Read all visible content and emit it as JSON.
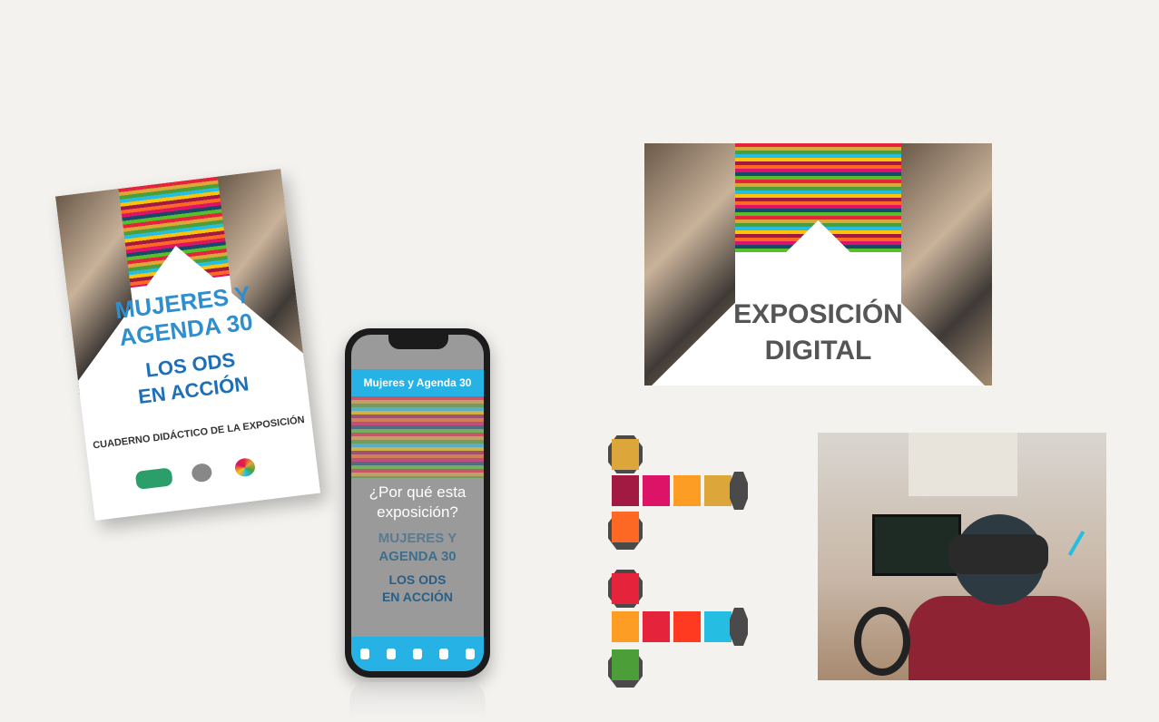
{
  "booklet": {
    "title_line1": "MUJERES Y",
    "title_line2": "AGENDA 30",
    "title_line3": "LOS ODS",
    "title_line4": "EN ACCIÓN",
    "subtitle": "CUADERNO DIDÁCTICO DE LA EXPOSICIÓN"
  },
  "phone": {
    "app_title": "Mujeres y Agenda 30",
    "question_line1": "¿Por qué esta",
    "question_line2": "exposición?",
    "bg_line1": "MUJERES Y",
    "bg_line2": "AGENDA 30",
    "bg_line3": "LOS ODS",
    "bg_line4": "EN ACCIÓN"
  },
  "expo": {
    "line1": "EXPOSICIÓN",
    "line2": "DIGITAL"
  },
  "sdg_colors": [
    "#e5243b",
    "#dda63a",
    "#4c9f38",
    "#c5192d",
    "#ff3a21",
    "#26bde2",
    "#fcc30b",
    "#a21942",
    "#fd6925",
    "#dd1367",
    "#fd9d24",
    "#bf8b2e",
    "#3f7e44",
    "#0a97d9",
    "#56c02b",
    "#00689d",
    "#19486a"
  ],
  "icons": [
    "vr-headset-icon",
    "controller-icon",
    "monitor-icon"
  ]
}
